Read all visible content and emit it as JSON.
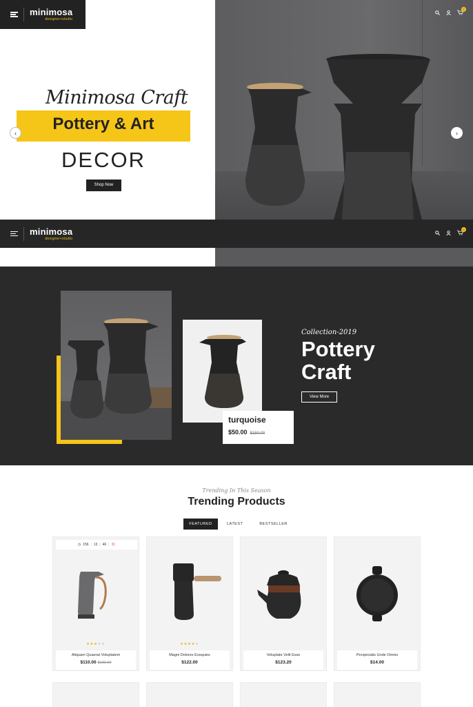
{
  "brand": {
    "name": "minimosa",
    "tagline": "designer+studio"
  },
  "hero": {
    "script_title": "Minimosa Craft",
    "headline": "Pottery & Art",
    "subheadline": "DECOR",
    "cta": "Shop Now",
    "prev_icon": "chevron-left-icon",
    "next_icon": "chevron-right-icon"
  },
  "header": {
    "cart_count": "0",
    "icons": [
      "menu-icon",
      "search-icon",
      "user-icon",
      "cart-icon"
    ]
  },
  "collection": {
    "tag": "Collection-2019",
    "title_line1": "Pottery",
    "title_line2": "Craft",
    "cta": "View More",
    "featured": {
      "name": "turquoise",
      "price": "$50.00",
      "old_price": "$150.00"
    }
  },
  "trending": {
    "subtitle": "Trending In This Season",
    "title": "Trending Products",
    "tabs": [
      "FEATURED",
      "LATEST",
      "BESTSELLER"
    ],
    "products": [
      {
        "name": "Aliquam Quaerat Voluptatem",
        "price": "$110.00",
        "old_price": "$132.00",
        "rating": 3,
        "timer": {
          "days": "156",
          "hours": "13",
          "minutes": "46",
          "seconds": "31"
        }
      },
      {
        "name": "Magni Dolores Eosquies",
        "price": "$122.00",
        "old_price": "",
        "rating": 4
      },
      {
        "name": "Voluptate Velit Esse",
        "price": "$123.20",
        "old_price": ""
      },
      {
        "name": "Perspiciatis Unde Omnis",
        "price": "$14.00",
        "old_price": ""
      }
    ]
  },
  "colors": {
    "accent": "#f5c518",
    "dark": "#2a2a2b",
    "header": "#262627"
  }
}
